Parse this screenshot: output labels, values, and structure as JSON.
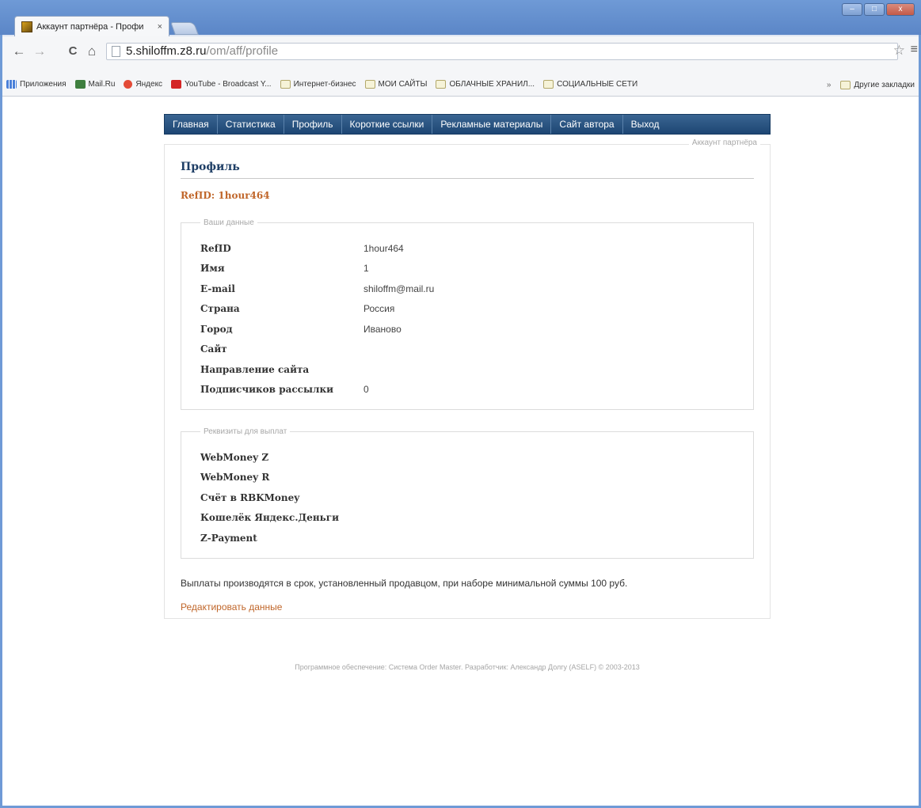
{
  "browser": {
    "tab_title": "Аккаунт партнёра - Профи",
    "tab_close": "×",
    "url_host": "5.shiloffm.z8.ru",
    "url_path": "/om/aff/profile",
    "nav": {
      "back": "←",
      "forward": "→",
      "reload": "C",
      "home": "⌂"
    },
    "star": "☆",
    "menu": "≡",
    "window_controls": {
      "minimize": "–",
      "maximize": "□",
      "close": "x"
    }
  },
  "bookmarks": {
    "items": [
      {
        "label": "Приложения",
        "icon": "apps-icon"
      },
      {
        "label": "Mail.Ru",
        "icon": "mail-icon"
      },
      {
        "label": "Яндекс",
        "icon": "yandex-icon"
      },
      {
        "label": "YouTube - Broadcast Y...",
        "icon": "youtube-icon"
      },
      {
        "label": "Интернет-бизнес",
        "icon": "folder-icon"
      },
      {
        "label": "МОИ САЙТЫ",
        "icon": "folder-icon"
      },
      {
        "label": "ОБЛАЧНЫЕ ХРАНИЛ...",
        "icon": "folder-icon"
      },
      {
        "label": "СОЦИАЛЬНЫЕ СЕТИ",
        "icon": "folder-icon"
      }
    ],
    "more": "»",
    "other": "Другие закладки"
  },
  "menu": {
    "items": [
      "Главная",
      "Статистика",
      "Профиль",
      "Короткие ссылки",
      "Рекламные материалы",
      "Сайт автора",
      "Выход"
    ]
  },
  "account": {
    "legend": "Аккаунт партнёра",
    "title": "Профиль",
    "refid_line": "RefID: 1hour464",
    "data_legend": "Ваши данные",
    "data_rows": [
      {
        "label": "RefID",
        "value": "1hour464"
      },
      {
        "label": "Имя",
        "value": "1"
      },
      {
        "label": "E-mail",
        "value": "shiloffm@mail.ru"
      },
      {
        "label": "Страна",
        "value": "Россия"
      },
      {
        "label": "Город",
        "value": "Иваново"
      },
      {
        "label": "Сайт",
        "value": ""
      },
      {
        "label": "Направление сайта",
        "value": ""
      },
      {
        "label": "Подписчиков рассылки",
        "value": "0"
      }
    ],
    "payments_legend": "Реквизиты для выплат",
    "payment_rows": [
      {
        "label": "WebMoney Z",
        "value": ""
      },
      {
        "label": "WebMoney R",
        "value": ""
      },
      {
        "label": "Счёт в RBKMoney",
        "value": ""
      },
      {
        "label": "Кошелёк Яндекс.Деньги",
        "value": ""
      },
      {
        "label": "Z-Payment",
        "value": ""
      }
    ],
    "notice": "Выплаты производятся в срок, установленный продавцом, при наборе минимальной суммы 100 руб.",
    "edit_link": "Редактировать данные"
  },
  "footer": "Программное обеспечение: Система Order Master. Разработчик: Александр Долгу (ASELF) © 2003-2013"
}
